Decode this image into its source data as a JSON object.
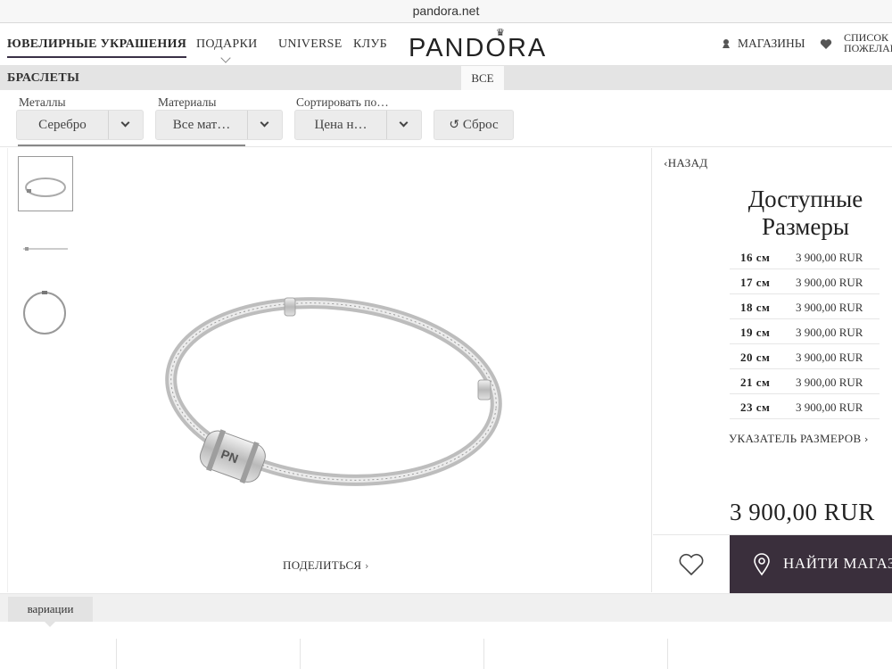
{
  "browser": {
    "url": "pandora.net"
  },
  "nav": {
    "jewelry": "ЮВЕЛИРНЫЕ УКРАШЕНИЯ",
    "gifts": "ПОДАРКИ",
    "universe": "UNIVERSE",
    "club": "КЛУБ",
    "logo": "PANDORA",
    "stores": "МАГАЗИНЫ",
    "wishlist_line1": "СПИСОК",
    "wishlist_line2": "ПОЖЕЛАНИЙ"
  },
  "category": {
    "title": "БРАСЛЕТЫ",
    "tab_all": "ВСЕ"
  },
  "filters": {
    "metals_label": "Металлы",
    "metals_value": "Серебро",
    "materials_label": "Материалы",
    "materials_value": "Все мат…",
    "sort_label": "Сортировать по…",
    "sort_value": "Цена н…",
    "reset": "Сброс"
  },
  "product": {
    "share": "ПОДЕЛИТЬСЯ",
    "back": "НАЗАД",
    "sizes_title_1": "Доступные",
    "sizes_title_2": "Размеры",
    "sizes": [
      {
        "size": "16 см",
        "price": "3 900,00 RUR"
      },
      {
        "size": "17 см",
        "price": "3 900,00 RUR"
      },
      {
        "size": "18 см",
        "price": "3 900,00 RUR"
      },
      {
        "size": "19 см",
        "price": "3 900,00 RUR"
      },
      {
        "size": "20 см",
        "price": "3 900,00 RUR"
      },
      {
        "size": "21 см",
        "price": "3 900,00 RUR"
      },
      {
        "size": "23 см",
        "price": "3 900,00 RUR"
      }
    ],
    "size_guide": "УКАЗАТЕЛЬ РАЗМЕРОВ",
    "price": "3 900,00 RUR",
    "find_store": "НАЙТИ МАГАЗИН"
  },
  "variations": {
    "tab": "вариации"
  },
  "colors": {
    "accent": "#3a2f3c",
    "bar": "#e4e4e4"
  }
}
